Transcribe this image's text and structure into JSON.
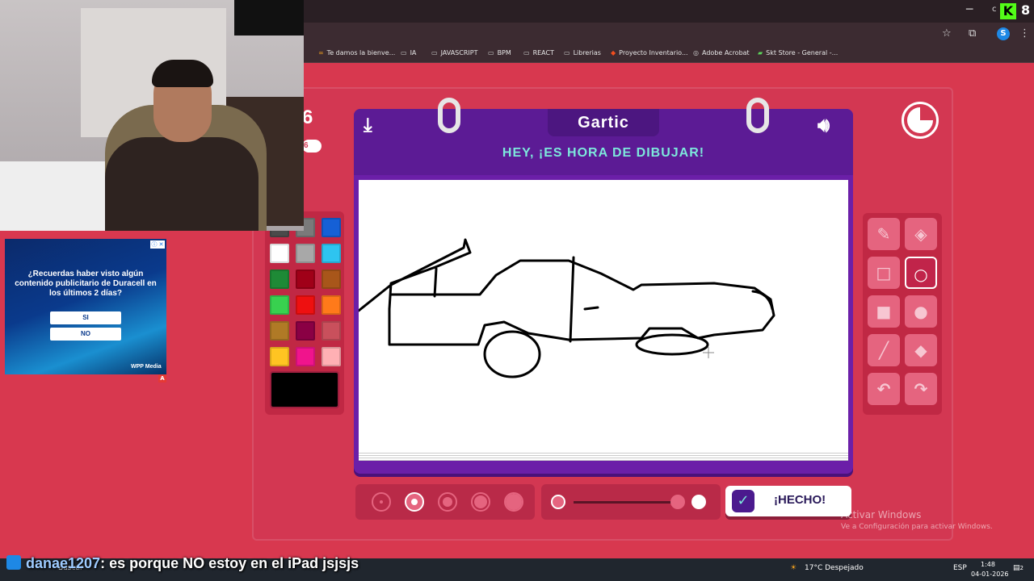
{
  "browser": {
    "minimize_glyph": "─",
    "bookmarks": [
      {
        "label": "Te damos la bienve...",
        "icon": "infinity-icon"
      },
      {
        "label": "IA",
        "icon": "folder-icon"
      },
      {
        "label": "JAVASCRIPT",
        "icon": "folder-icon"
      },
      {
        "label": "BPM",
        "icon": "folder-icon"
      },
      {
        "label": "REACT",
        "icon": "folder-icon"
      },
      {
        "label": "Librerias",
        "icon": "folder-icon"
      },
      {
        "label": "Proyecto Inventario...",
        "icon": "figma-icon"
      },
      {
        "label": "Adobe Acrobat",
        "icon": "globe-icon"
      },
      {
        "label": "Skt Store - General -...",
        "icon": "app-icon"
      }
    ],
    "profile_initial": "S"
  },
  "game": {
    "logo": "Gartic",
    "title": "HEY, ¡ES HORA DE DIBUJAR!",
    "round_number": "6",
    "round_pill": "6",
    "done_label": "¡HECHO!",
    "done_check": "✓",
    "timer_remaining_fraction": 0.75,
    "palette": [
      "#4a4a4a",
      "#7a7a7a",
      "#1560d6",
      "#ffffff",
      "#a8a8a8",
      "#2ec4f0",
      "#1e8a36",
      "#a00018",
      "#a8561a",
      "#38d14f",
      "#ee1010",
      "#ff7a1a",
      "#b07a26",
      "#8a0044",
      "#c9505c",
      "#ffc422",
      "#f0148c",
      "#ffb0b4"
    ],
    "current_color": "#000000",
    "tools": [
      {
        "name": "pencil-tool",
        "glyph": "✎",
        "active": false
      },
      {
        "name": "eraser-tool",
        "glyph": "◈",
        "active": false
      },
      {
        "name": "rectangle-outline-tool",
        "glyph": "□",
        "active": false
      },
      {
        "name": "ellipse-outline-tool",
        "glyph": "○",
        "active": true
      },
      {
        "name": "rectangle-fill-tool",
        "glyph": "■",
        "active": false
      },
      {
        "name": "ellipse-fill-tool",
        "glyph": "●",
        "active": false
      },
      {
        "name": "line-tool",
        "glyph": "╱",
        "active": false
      },
      {
        "name": "fill-bucket-tool",
        "glyph": "◆",
        "active": false
      },
      {
        "name": "undo-tool",
        "glyph": "↶",
        "active": false
      },
      {
        "name": "redo-tool",
        "glyph": "↷",
        "active": false
      }
    ],
    "brush_sizes_selected_index": 1,
    "opacity_level": 1.0
  },
  "ad": {
    "question": "¿Recuerdas haber visto algún contenido publicitario de Duracell en los últimos 2 días?",
    "yes": "SI",
    "no": "NO",
    "brand": "WPP Media",
    "info_glyph": "ⓘ ✕",
    "badge": "A"
  },
  "overlay": {
    "kick_logo": "K",
    "kick_count": "8",
    "corner_char": "c",
    "chat_user": "danae1207",
    "chat_message": ": es porque NO estoy en el iPad jsjsjs"
  },
  "watermark": {
    "line1": "Activar Windows",
    "line2": "Ve a Configuración para activar Windows."
  },
  "taskbar": {
    "search": "Buscar",
    "weather": "17°C  Despejado",
    "lang": "ESP",
    "time": "1:48",
    "date": "04-01-2026",
    "notification_count": "2"
  }
}
